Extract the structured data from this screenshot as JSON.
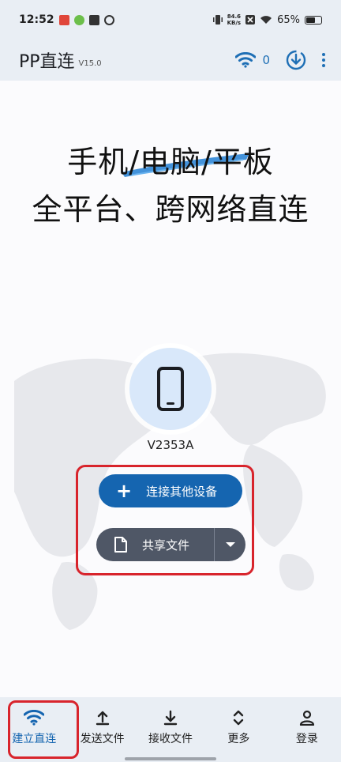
{
  "status_bar": {
    "time": "12:52",
    "net_speed_value": "84.6",
    "net_speed_unit": "KB/s",
    "battery": "65%",
    "battery_level": 0.65
  },
  "app_bar": {
    "title": "PP直连",
    "version": "V15.0",
    "connection_count": "0",
    "icons": [
      "wifi-icon",
      "download-icon",
      "more-vert-icon"
    ]
  },
  "hero": {
    "line1": "手机/电脑/平板",
    "line2": "全平台、跨网络直连"
  },
  "device": {
    "name": "V2353A",
    "icon": "phone-icon"
  },
  "actions": {
    "connect_label": "连接其他设备",
    "share_label": "共享文件"
  },
  "bottom_nav": {
    "items": [
      {
        "label": "建立直连",
        "icon": "wifi-icon",
        "active": true
      },
      {
        "label": "发送文件",
        "icon": "upload-icon",
        "active": false
      },
      {
        "label": "接收文件",
        "icon": "download-icon",
        "active": false
      },
      {
        "label": "更多",
        "icon": "expand-icon",
        "active": false
      },
      {
        "label": "登录",
        "icon": "person-icon",
        "active": false
      }
    ]
  },
  "colors": {
    "accent": "#1565b0",
    "share_button": "#4f5766",
    "highlight_red": "#d8242c",
    "bar_background": "#e9eef4"
  }
}
